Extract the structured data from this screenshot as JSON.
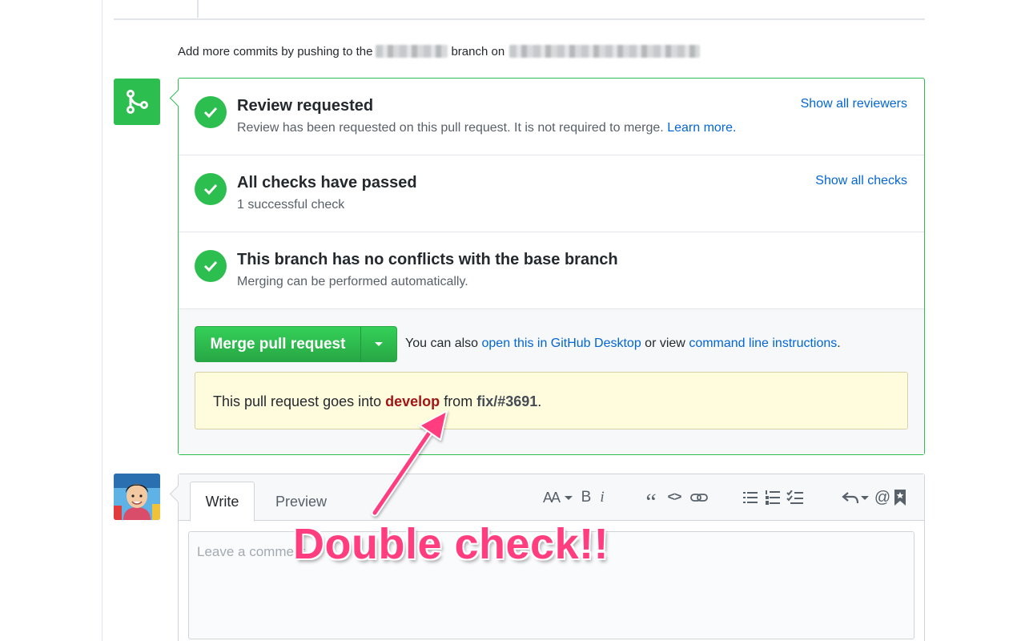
{
  "push_hint": {
    "prefix": "Add more commits by pushing to the",
    "middle": "branch on"
  },
  "status_items": [
    {
      "title": "Review requested",
      "desc": "Review has been requested on this pull request. It is not required to merge.",
      "desc_link": "Learn more.",
      "action": "Show all reviewers"
    },
    {
      "title": "All checks have passed",
      "desc": "1 successful check",
      "action": "Show all checks"
    },
    {
      "title": "This branch has no conflicts with the base branch",
      "desc": "Merging can be performed automatically."
    }
  ],
  "merge": {
    "button_label": "Merge pull request",
    "alt_prefix": "You can also",
    "alt_link_desktop": "open this in GitHub Desktop",
    "alt_middle": "or view",
    "alt_link_cli": "command line instructions",
    "alt_suffix": "."
  },
  "info": {
    "prefix": "This pull request goes into",
    "base_branch": "develop",
    "middle": "from",
    "head_branch": "fix/#3691",
    "suffix": "."
  },
  "comment": {
    "tab_write": "Write",
    "tab_preview": "Preview",
    "placeholder": "Leave a comment",
    "toolbar": {
      "heading": "AA",
      "bold": "B",
      "italic": "i",
      "quote": "“",
      "code": "<>",
      "mention": "@"
    }
  },
  "annotation": {
    "text": "Double check!!",
    "color": "#ff3d7f"
  },
  "colors": {
    "success": "#2cbe4e",
    "link": "#0366d6",
    "base_branch": "#a31515",
    "info_bg": "#fffbdd"
  }
}
